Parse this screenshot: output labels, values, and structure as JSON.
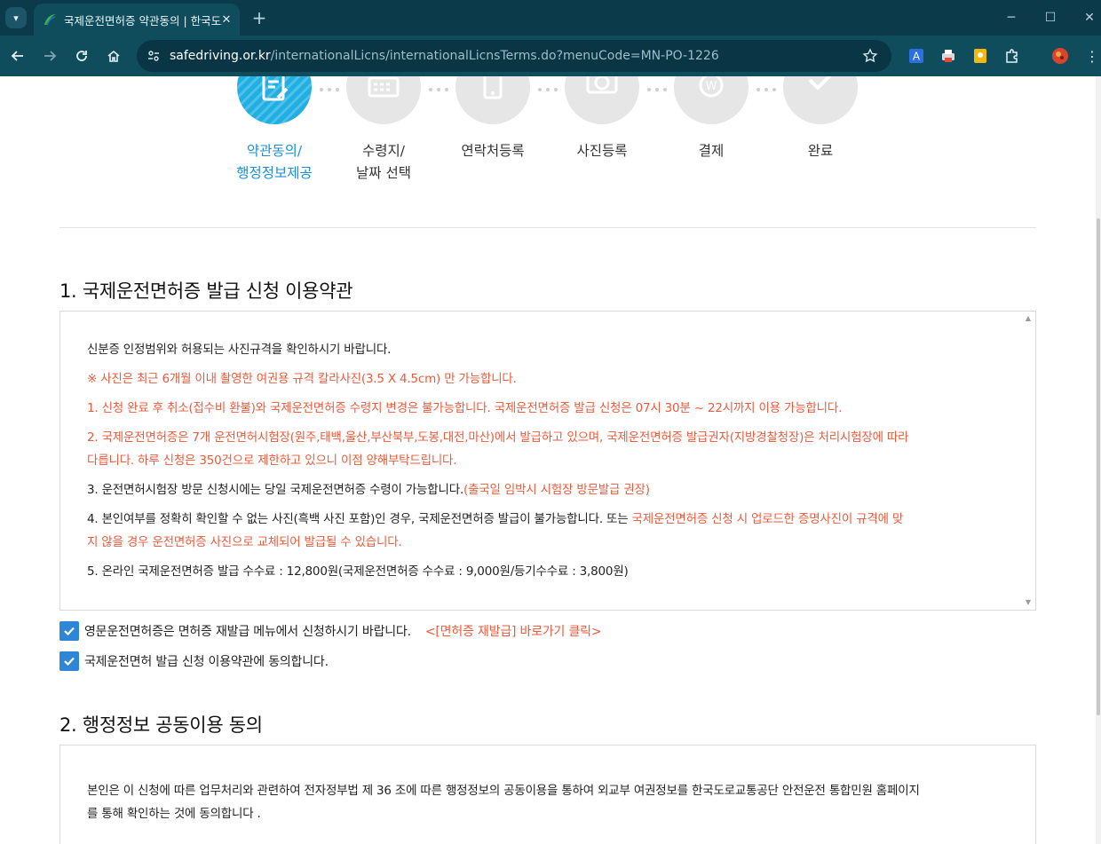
{
  "browser": {
    "tab_title": "국제운전면허증 약관동의 | 한국도로교통공단",
    "url_host": "safedriving.or.kr",
    "url_path": "/internationalLicns/internationalLicnsTerms.do?menuCode=MN-PO-1226",
    "accent": "#0f4c5c"
  },
  "steps": [
    {
      "line1": "약관동의/",
      "line2": "행정정보제공",
      "icon": "document-pen-icon",
      "active": true
    },
    {
      "line1": "수령지/",
      "line2": "날짜 선택",
      "icon": "calendar-icon",
      "active": false
    },
    {
      "line1": "연락처등록",
      "line2": "",
      "icon": "phone-icon",
      "active": false
    },
    {
      "line1": "사진등록",
      "line2": "",
      "icon": "camera-icon",
      "active": false
    },
    {
      "line1": "결제",
      "line2": "",
      "icon": "won-icon",
      "active": false
    },
    {
      "line1": "완료",
      "line2": "",
      "icon": "check-icon",
      "active": false
    }
  ],
  "section1": {
    "title": "1. 국제운전면허증 발급 신청 이용약관",
    "intro": "신분증 인정범위와 허용되는 사진규격을 확인하시기 바랍니다.",
    "note": "※ 사진은 최근 6개월 이내 촬영한 여권용 규격 칼라사진(3.5 X 4.5cm) 만 가능합니다.",
    "item1": "1. 신청 완료 후 취소(접수비 환불)와 국제운전면허증 수령지 변경은 불가능합니다. 국제운전면허증 발급 신청은 07시 30분 ~ 22시까지 이용 가능합니다.",
    "item2_a": "2. 국제운전면허증은 7개 운전면허시험장(원주,태백,울산,부산북부,도봉,대전,마산)에서 발급하고 있으며, 국제운전면허증 발급권자(지방경찰청장)은 처리시험장에 따라",
    "item2_b": "다릅니다. 하루 신청은 350건으로 제한하고 있으니 이점 양해부탁드립니다.",
    "item3": "3. 운전면허시험장 방문 신청시에는 당일 국제운전면허증 수령이 가능합니다.",
    "item3_red": "(출국일 임박시 시험장 방문발급 권장)",
    "item4_a": "4. 본인여부를 정확히 확인할 수 없는 사진(흑백 사진 포함)인 경우, 국제운전면허증 발급이 불가능합니다. 또는 ",
    "item4_a_red": "국제운전면허증 신청 시 업로드한 증명사진이 규격에 맞",
    "item4_b": "지 않을 경우 운전면허증 사진으로 교체되어 발급될 수 있습니다.",
    "item5": "5. 온라인 국제운전면허증 발급 수수료 : 12,800원(국제운전면허증 수수료 : 9,000원/등기수수료 : 3,800원)"
  },
  "checks": {
    "english_license_text": "영문운전면허증은 면허증 재발급 메뉴에서 신청하시기 바랍니다.",
    "english_license_link": "<[면허증 재발급] 바로가기 클릭>",
    "agree_terms_text": "국제운전면허 발급 신청 이용약관에 동의합니다."
  },
  "section2": {
    "title": "2. 행정정보 공동이용 동의",
    "line1": "본인은 이 신청에 따른 업무처리와 관련하여 전자정부법 제 36 조에 따른 행정정보의 공동이용을 통하여 외교부 여권정보를 한국도로교통공단 안전운전 통합민원 홈페이지",
    "line2": "를 통해 확인하는 것에 동의합니다 ."
  }
}
